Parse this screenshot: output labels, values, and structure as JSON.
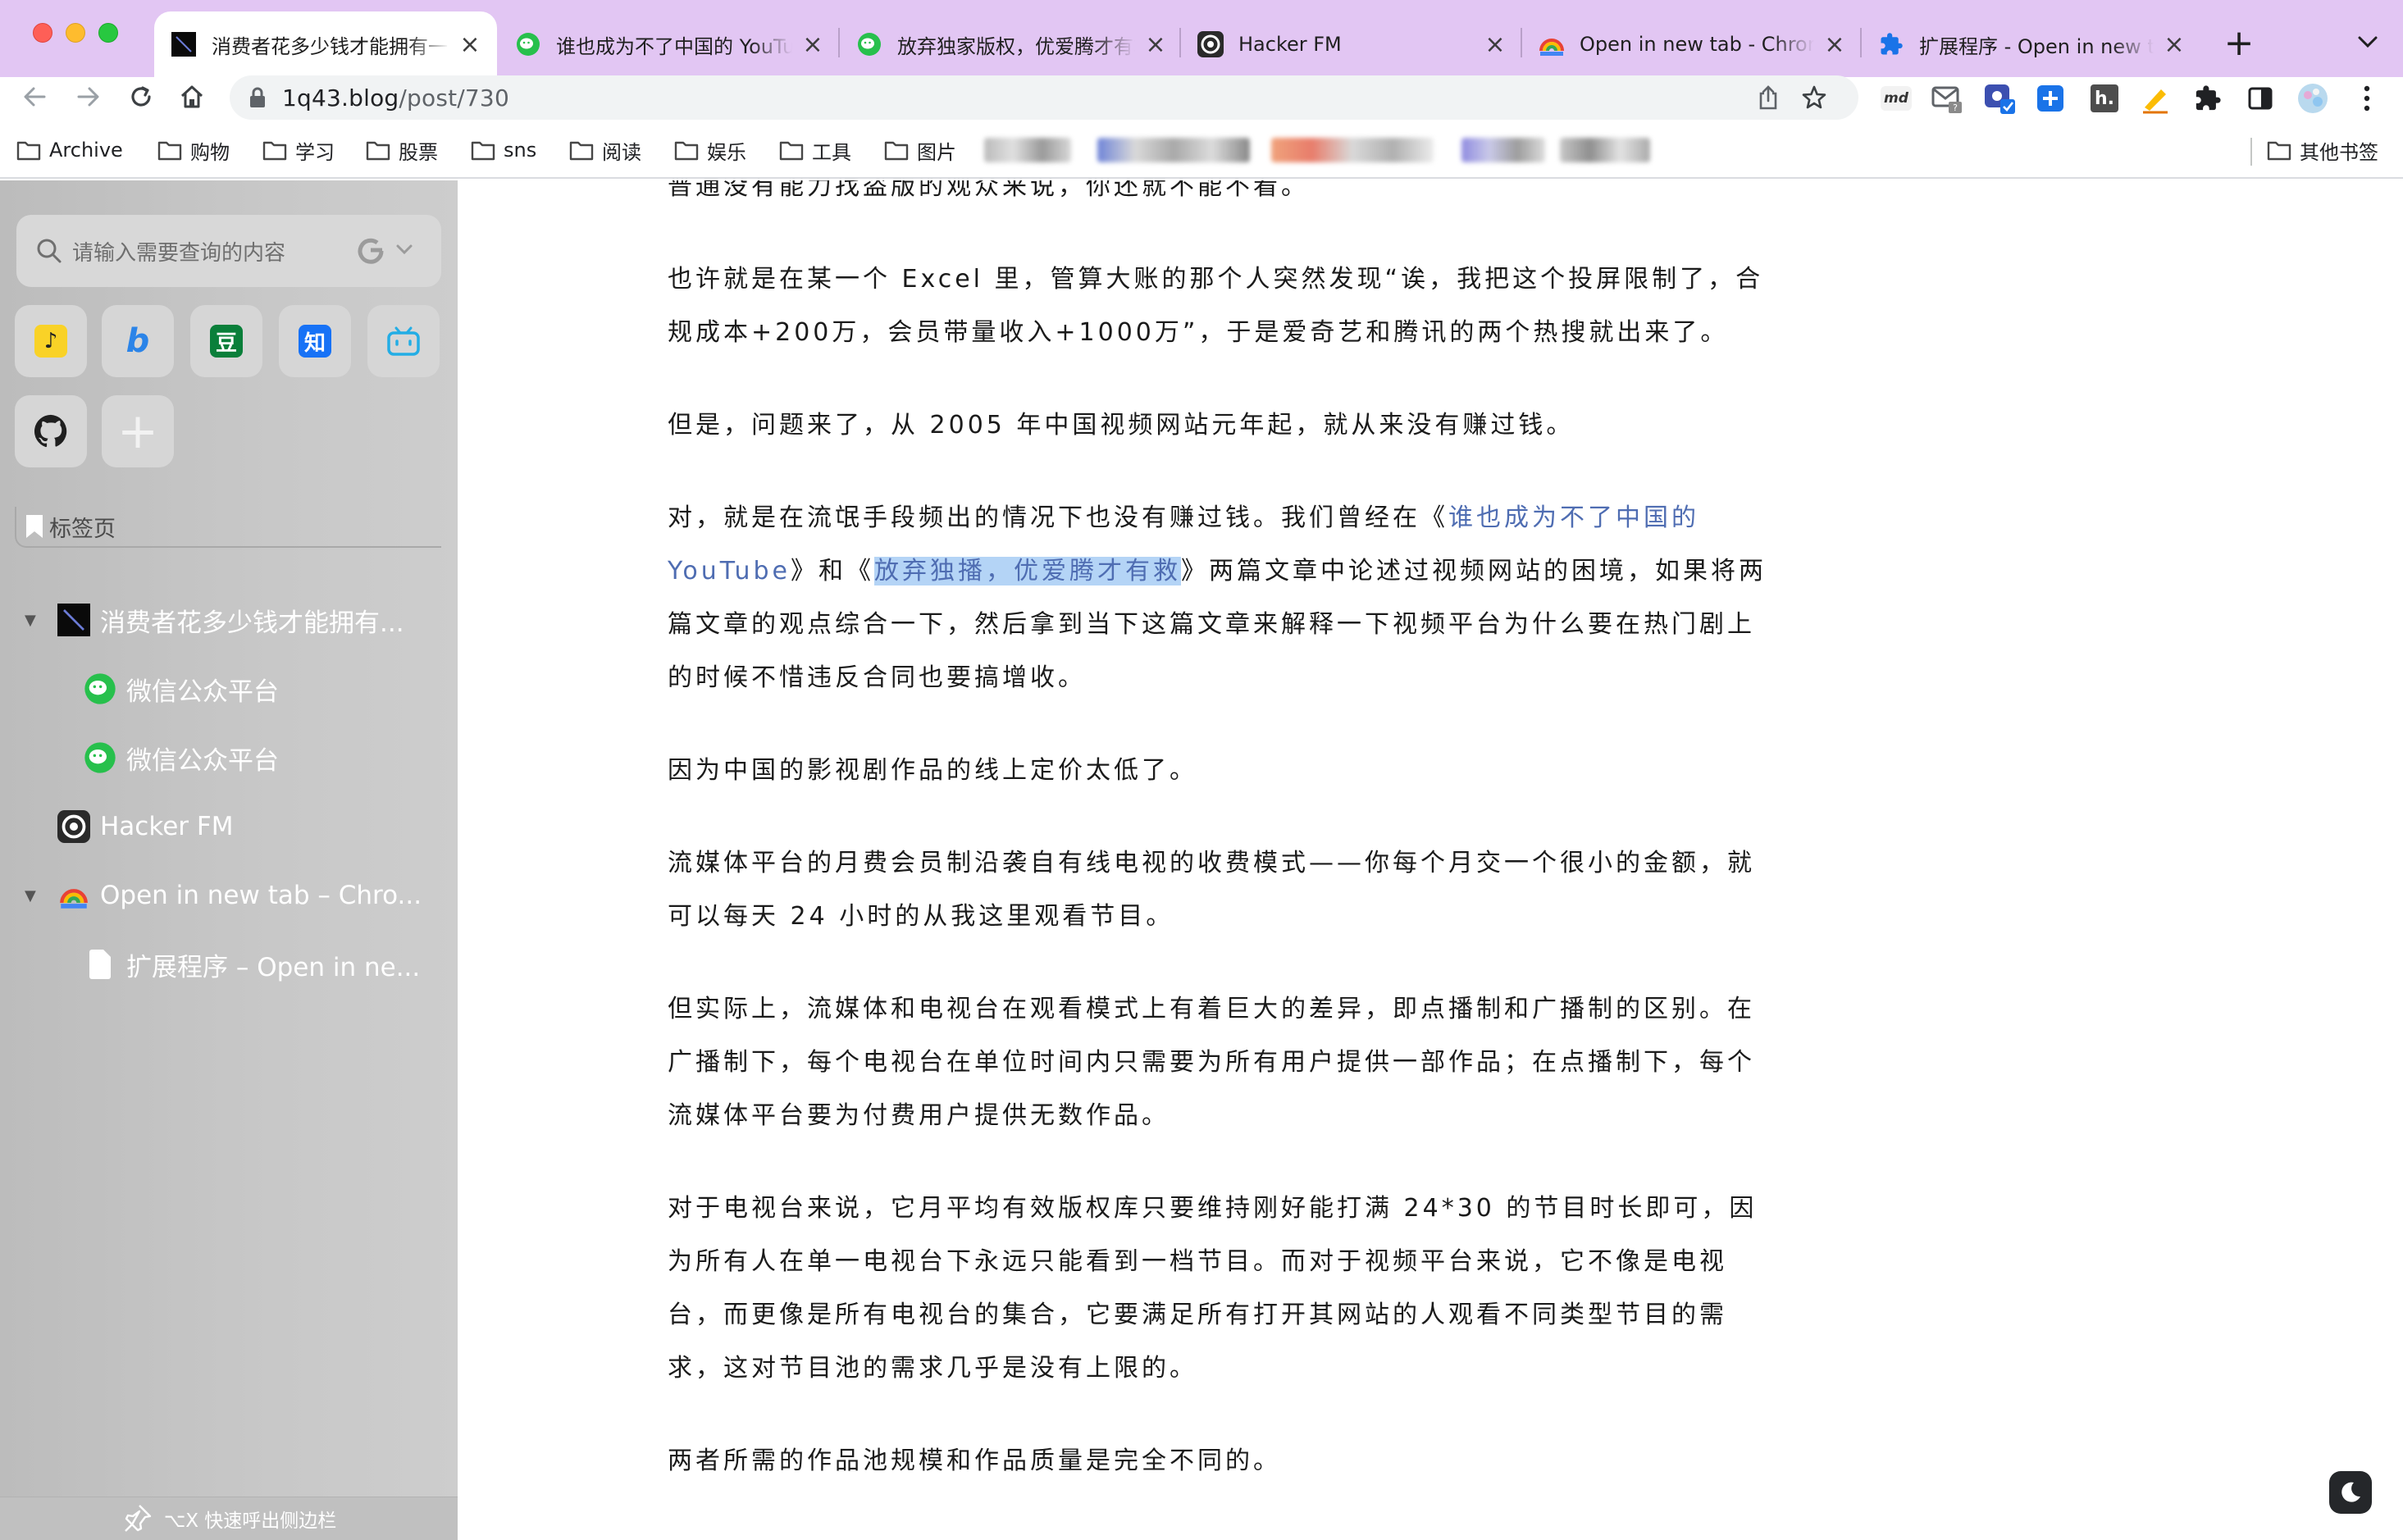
{
  "tabs": [
    {
      "title": "消费者花多少钱才能拥有一",
      "favicon": "black-square-icon",
      "active": true
    },
    {
      "title": "谁也成为不了中国的 YouTube",
      "favicon": "wechat-icon",
      "active": false
    },
    {
      "title": "放弃独家版权，优爱腾才有救",
      "favicon": "wechat-icon",
      "active": false
    },
    {
      "title": "Hacker FM",
      "favicon": "hackerfm-icon",
      "active": false
    },
    {
      "title": "Open in new tab - Chrome",
      "favicon": "chrome-rainbow-icon",
      "active": false
    },
    {
      "title": "扩展程序 - Open in new tab",
      "favicon": "puzzle-icon",
      "active": false
    }
  ],
  "address_bar": {
    "host": "1q43.blog",
    "path": "/post/730"
  },
  "extensions": [
    {
      "name": "markdown-extension-icon",
      "label": "md"
    },
    {
      "name": "gmail-checker-icon",
      "label": ""
    },
    {
      "name": "screen-capture-icon",
      "label": ""
    },
    {
      "name": "add-extension-icon",
      "label": ""
    },
    {
      "name": "hypothesis-icon",
      "label": "h."
    },
    {
      "name": "highlighter-icon",
      "label": ""
    },
    {
      "name": "extensions-puzzle-icon",
      "label": ""
    },
    {
      "name": "sidebar-panel-icon",
      "label": ""
    },
    {
      "name": "profile-avatar-icon",
      "label": ""
    },
    {
      "name": "more-menu-icon",
      "label": ""
    }
  ],
  "bookmarks": {
    "folders": [
      "Archive",
      "购物",
      "学习",
      "股票",
      "sns",
      "阅读",
      "娱乐",
      "工具",
      "图片"
    ],
    "other": "其他书签"
  },
  "sidebar": {
    "search_placeholder": "请输入需要查询的内容",
    "quick_links": [
      {
        "name": "yuque-link-icon",
        "glyph": "♪",
        "color": "#f9d227"
      },
      {
        "name": "bing-link-icon",
        "glyph": "b",
        "color": "#2b84e8"
      },
      {
        "name": "douban-link-icon",
        "glyph": "豆",
        "color": "#0a7f3a"
      },
      {
        "name": "zhihu-link-icon",
        "glyph": "知",
        "color": "#1772f6"
      },
      {
        "name": "bilibili-link-icon",
        "glyph": "▭",
        "color": "#23ade5"
      },
      {
        "name": "github-link-icon",
        "glyph": "",
        "color": "#1f1f1f"
      },
      {
        "name": "add-link-icon",
        "glyph": "+",
        "color": ""
      }
    ],
    "bookmark_tab_label": "标签页",
    "tree": [
      {
        "label": "消费者花多少钱才能拥有...",
        "level": 0,
        "expanded": true,
        "favicon": "black-square-icon"
      },
      {
        "label": "微信公众平台",
        "level": 1,
        "favicon": "wechat-icon"
      },
      {
        "label": "微信公众平台",
        "level": 1,
        "favicon": "wechat-icon"
      },
      {
        "label": "Hacker FM",
        "level": 0,
        "favicon": "hackerfm-icon"
      },
      {
        "label": "Open in new tab – Chro...",
        "level": 0,
        "expanded": true,
        "favicon": "chrome-rainbow-icon"
      },
      {
        "label": "扩展程序 – Open in ne...",
        "level": 1,
        "favicon": "page-icon"
      }
    ],
    "footer_hint": "⌥X 快速呼出侧边栏"
  },
  "article": {
    "p0": "普通没有能力找盗版的观众来说，你还就不能不看。",
    "p1": "也许就是在某一个 Excel 里，管算大账的那个人突然发现“诶，我把这个投屏限制了，合规成本+200万，会员带量收入+1000万”，于是爱奇艺和腾讯的两个热搜就出来了。",
    "p2": "但是，问题来了，从 2005 年中国视频网站元年起，就从来没有赚过钱。",
    "p3_a": "对，就是在流氓手段频出的情况下也没有赚过钱。我们曾经在《",
    "p3_link1": "谁也成为不了中国的 YouTube",
    "p3_b": "》和《",
    "p3_link2": "放弃独播，优爱腾才有救",
    "p3_c": "》两篇文章中论述过视频网站的困境，如果将两篇文章的观点综合一下，然后拿到当下这篇文章来解释一下视频平台为什么要在热门剧上的时候不惜违反合同也要搞增收。",
    "p4": "因为中国的影视剧作品的线上定价太低了。",
    "p5": "流媒体平台的月费会员制沿袭自有线电视的收费模式——你每个月交一个很小的金额，就可以每天 24 小时的从我这里观看节目。",
    "p6": "但实际上，流媒体和电视台在观看模式上有着巨大的差异，即点播制和广播制的区别。在广播制下，每个电视台在单位时间内只需要为所有用户提供一部作品；在点播制下，每个流媒体平台要为付费用户提供无数作品。",
    "p7": "对于电视台来说，它月平均有效版权库只要维持刚好能打满 24*30 的节目时长即可，因为所有人在单一电视台下永远只能看到一档节目。而对于视频平台来说，它不像是电视台，而更像是所有电视台的集合，它要满足所有打开其网站的人观看不同类型节目的需求，这对节目池的需求几乎是没有上限的。",
    "p8": "两者所需的作品池规模和作品质量是完全不同的。"
  }
}
